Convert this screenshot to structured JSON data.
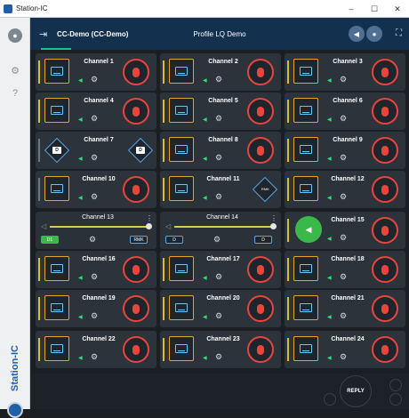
{
  "window": {
    "title": "Station-IC",
    "minimize": "–",
    "maximize": "☐",
    "close": "✕"
  },
  "sidebar": {
    "avatar_icon": "user-icon",
    "settings_icon": "gear-icon",
    "help_icon": "help-icon",
    "brand": "Station-IC"
  },
  "header": {
    "exit_glyph": "⇥",
    "station_name": "CC-Demo  (CC-Demo)",
    "profile": "Profile LQ Demo",
    "speaker_glyph": "🔊",
    "mic_glyph": "🎤",
    "expand_glyph": "⛶"
  },
  "channels": [
    {
      "name": "Channel 1"
    },
    {
      "name": "Channel 2"
    },
    {
      "name": "Channel 3"
    },
    {
      "name": "Channel 4"
    },
    {
      "name": "Channel 5"
    },
    {
      "name": "Channel 6"
    },
    {
      "name": "Channel 7",
      "left_badge": "D",
      "right_badge": "D"
    },
    {
      "name": "Channel 8"
    },
    {
      "name": "Channel 9"
    },
    {
      "name": "Channel 10"
    },
    {
      "name": "Channel 11",
      "right_badge": "RMK"
    },
    {
      "name": "Channel 12"
    },
    {
      "name": "Channel 13",
      "left_pill": "D1",
      "right_pill": "RMK"
    },
    {
      "name": "Channel 14",
      "left_pill": "D",
      "right_pill": "D"
    },
    {
      "name": "Channel 15"
    },
    {
      "name": "Channel 16"
    },
    {
      "name": "Channel 17"
    },
    {
      "name": "Channel 18"
    },
    {
      "name": "Channel 19"
    },
    {
      "name": "Channel 20"
    },
    {
      "name": "Channel 21"
    },
    {
      "name": "Channel 22"
    },
    {
      "name": "Channel 23"
    },
    {
      "name": "Channel 24"
    }
  ],
  "footer": {
    "reply": "REPLY"
  },
  "colors": {
    "accent": "#1f5fa8",
    "talk": "#e8463c",
    "key": "#e6a623",
    "listen": "#2ee07a"
  }
}
